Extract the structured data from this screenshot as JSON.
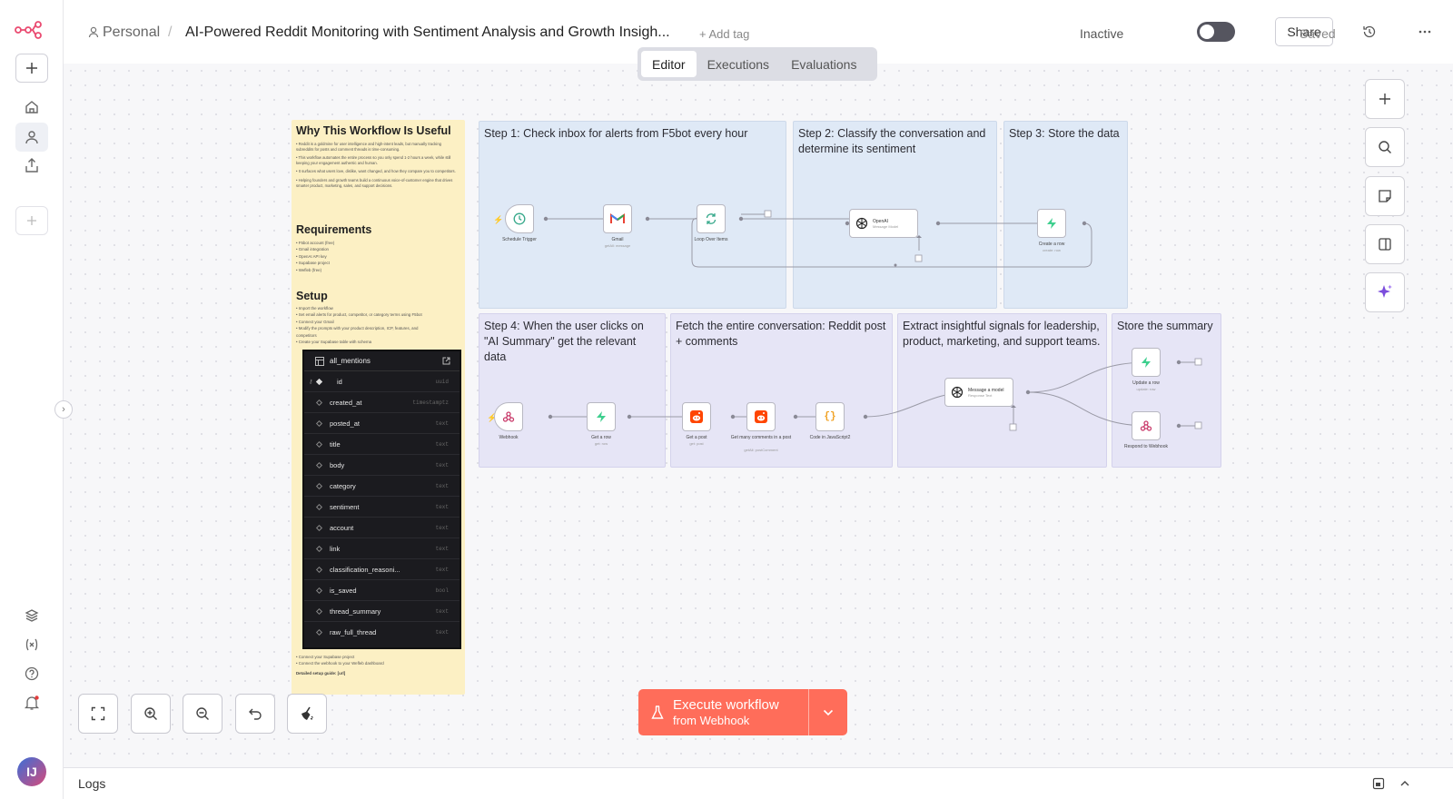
{
  "header": {
    "project_label": "Personal",
    "separator": "/",
    "workflow_title": "AI-Powered Reddit Monitoring with Sentiment Analysis and Growth Insigh...",
    "add_tag_label": "+ Add tag",
    "status_label": "Inactive",
    "active": false,
    "share_label": "Share",
    "saved_label": "Saved"
  },
  "tabs": [
    {
      "label": "Editor",
      "active": true
    },
    {
      "label": "Executions",
      "active": false
    },
    {
      "label": "Evaluations",
      "active": false
    }
  ],
  "sidebar": {
    "avatar_initials": "IJ",
    "notification_dot_color": "#e33d3d"
  },
  "colors": {
    "accent": "#ff6d5a",
    "sticky_yellow": "#fcf0c4",
    "sticky_blue": "#dfe9f6",
    "sticky_purple": "#e6e5f6"
  },
  "sticky_doc": {
    "title": "Why This Workflow Is Useful",
    "paragraphs": [
      "• Reddit is a goldmine for user intelligence and high-intent leads, but manually tracking subreddits for posts and comment threads is time-consuming.",
      "• This workflow automates the entire process so you only spend 1-2 hours a week, while still keeping your engagement authentic and human.",
      "• It surfaces what users love, dislike, want changed, and how they compare you to competitors.",
      "• Helping founders and growth teams build a continuous voice-of-customer engine that drives smarter product, marketing, sales, and support decisions."
    ],
    "requirements_title": "Requirements",
    "requirements": [
      "• F5bot account (free)",
      "• Gmail integration",
      "• OpenAI API key",
      "• Supabase project",
      "• Wefleb (free)"
    ],
    "setup_title": "Setup",
    "setup": [
      "• Import the workflow",
      "• Set email alerts for product, competitor, or category terms using F5bot",
      "• Connect your Gmail",
      "• Modify the prompts with your product description, ICP, features, and",
      "  competitors",
      "• Create your Supabase table with schema"
    ],
    "footer": [
      "• Connect your Supabase project",
      "• Connect the webhook to your Wefleb dashboard"
    ],
    "guide": "Detailed setup guide: [url]"
  },
  "schema": {
    "table_name": "all_mentions",
    "columns": [
      {
        "name": "id",
        "type": "uuid",
        "key": true
      },
      {
        "name": "created_at",
        "type": "timestamptz"
      },
      {
        "name": "posted_at",
        "type": "text"
      },
      {
        "name": "title",
        "type": "text"
      },
      {
        "name": "body",
        "type": "text"
      },
      {
        "name": "category",
        "type": "text"
      },
      {
        "name": "sentiment",
        "type": "text"
      },
      {
        "name": "account",
        "type": "text"
      },
      {
        "name": "link",
        "type": "text"
      },
      {
        "name": "classification_reasoni...",
        "type": "text"
      },
      {
        "name": "is_saved",
        "type": "bool"
      },
      {
        "name": "thread_summary",
        "type": "text"
      },
      {
        "name": "raw_full_thread",
        "type": "text"
      }
    ]
  },
  "sticky_notes": {
    "step1": "Step 1: Check inbox for alerts from F5bot every hour",
    "step2": "Step 2: Classify the conversation and determine its sentiment",
    "step3": "Step 3: Store the data",
    "step4": "Step 4: When the user clicks on \"AI Summary\" get the relevant data",
    "fetch": "Fetch the entire conversation: Reddit post + comments",
    "extract": "Extract insightful signals for leadership, product, marketing, and support teams.",
    "store_summary": "Store the summary"
  },
  "nodes": {
    "schedule": {
      "label": "Schedule Trigger",
      "icon": "clock-icon"
    },
    "gmail": {
      "label": "Gmail",
      "sub": "getAll: message",
      "icon": "gmail-icon"
    },
    "loop": {
      "label": "Loop Over Items",
      "icon": "loop-icon"
    },
    "openai": {
      "label": "OpenAI",
      "sub": "Message Model",
      "icon": "openai-icon"
    },
    "create_row": {
      "label": "Create a row",
      "sub": "create: row",
      "icon": "supabase-icon"
    },
    "webhook": {
      "label": "Webhook",
      "icon": "webhook-icon"
    },
    "get_row": {
      "label": "Get a row",
      "sub": "get: row",
      "icon": "supabase-icon"
    },
    "get_post": {
      "label": "Get a post",
      "sub": "get: post",
      "icon": "reddit-icon"
    },
    "get_comments": {
      "label": "Get many comments in a post",
      "sub": "getAll: postComment",
      "icon": "reddit-icon"
    },
    "code": {
      "label": "Code in JavaScript2",
      "icon": "code-icon"
    },
    "message_model": {
      "label": "Message a model",
      "sub": "Response Text",
      "icon": "openai-icon"
    },
    "update_row": {
      "label": "Update a row",
      "sub": "update: row",
      "icon": "supabase-icon"
    },
    "respond": {
      "label": "Respond to Webhook",
      "icon": "webhook-icon"
    }
  },
  "execute": {
    "line1": "Execute workflow",
    "line2": "from Webhook"
  },
  "logs": {
    "label": "Logs"
  }
}
